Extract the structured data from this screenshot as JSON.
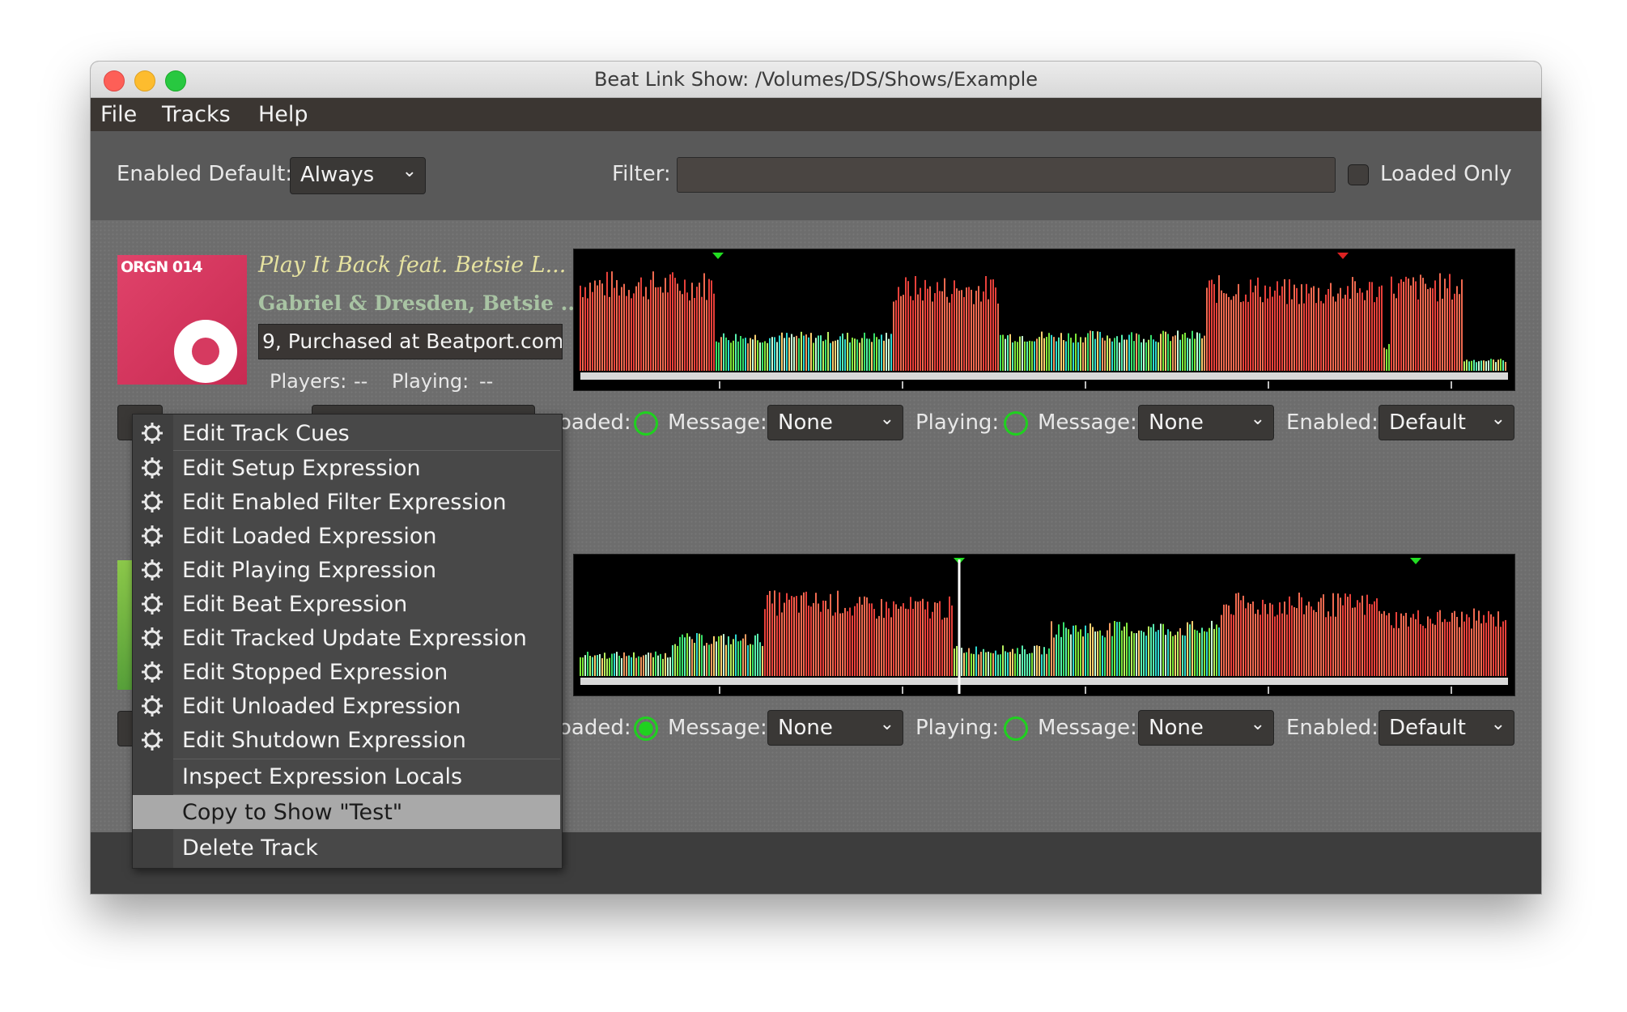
{
  "window": {
    "title": "Beat Link Show: /Volumes/DS/Shows/Example"
  },
  "menubar": {
    "items": [
      "File",
      "Tracks",
      "Help"
    ]
  },
  "toolbar": {
    "enabled_default_label": "Enabled Default:",
    "enabled_default_value": "Always",
    "filter_label": "Filter:",
    "filter_value": "",
    "loaded_only_label": "Loaded Only",
    "loaded_only_checked": false
  },
  "tracks": [
    {
      "art_text": "ORGN 014",
      "title": "Play It Back feat. Betsie L...",
      "artist": "Gabriel & Dresden, Betsie ...",
      "comment": "9, Purchased at Beatport.com",
      "players_label": "Players:",
      "players_value": "--",
      "playing_label": "Playing:",
      "playing_value": "--",
      "loaded_label": "oaded:",
      "loaded_active": false,
      "loaded_message_label": "Message:",
      "loaded_message_value": "None",
      "playing_state_label": "Playing:",
      "playing_active": false,
      "playing_message_label": "Message:",
      "playing_message_value": "None",
      "enabled_label": "Enabled:",
      "enabled_value": "Default"
    },
    {
      "loaded_label": "oaded:",
      "loaded_active": true,
      "loaded_message_label": "Message:",
      "loaded_message_value": "None",
      "playing_state_label": "Playing:",
      "playing_active": false,
      "playing_message_label": "Message:",
      "playing_message_value": "None",
      "enabled_label": "Enabled:",
      "enabled_value": "Default"
    }
  ],
  "context_menu": {
    "items": [
      {
        "label": "Edit Track Cues",
        "icon": "gear-icon"
      },
      {
        "label": "Edit Setup Expression",
        "icon": "gear-icon"
      },
      {
        "label": "Edit Enabled Filter Expression",
        "icon": "gear-icon"
      },
      {
        "label": "Edit Loaded Expression",
        "icon": "gear-icon"
      },
      {
        "label": "Edit Playing Expression",
        "icon": "gear-icon"
      },
      {
        "label": "Edit Beat Expression",
        "icon": "gear-icon"
      },
      {
        "label": "Edit Tracked Update Expression",
        "icon": "gear-icon"
      },
      {
        "label": "Edit Stopped Expression",
        "icon": "gear-icon"
      },
      {
        "label": "Edit Unloaded Expression",
        "icon": "gear-icon"
      },
      {
        "label": "Edit Shutdown Expression",
        "icon": "gear-icon"
      },
      {
        "label": "Inspect Expression Locals",
        "icon": ""
      },
      {
        "label": "Copy to Show \"Test\"",
        "icon": "",
        "selected": true
      },
      {
        "label": "Delete Track",
        "icon": ""
      }
    ]
  },
  "colors": {
    "menubar_bg": "#3b3632",
    "content_bg": "#6d6d6d",
    "indicator_green": "#1fd11f",
    "selection_bg": "#a9a9a9",
    "title_yellow": "#e6e2a0",
    "artist_green": "#a8c3a3"
  }
}
